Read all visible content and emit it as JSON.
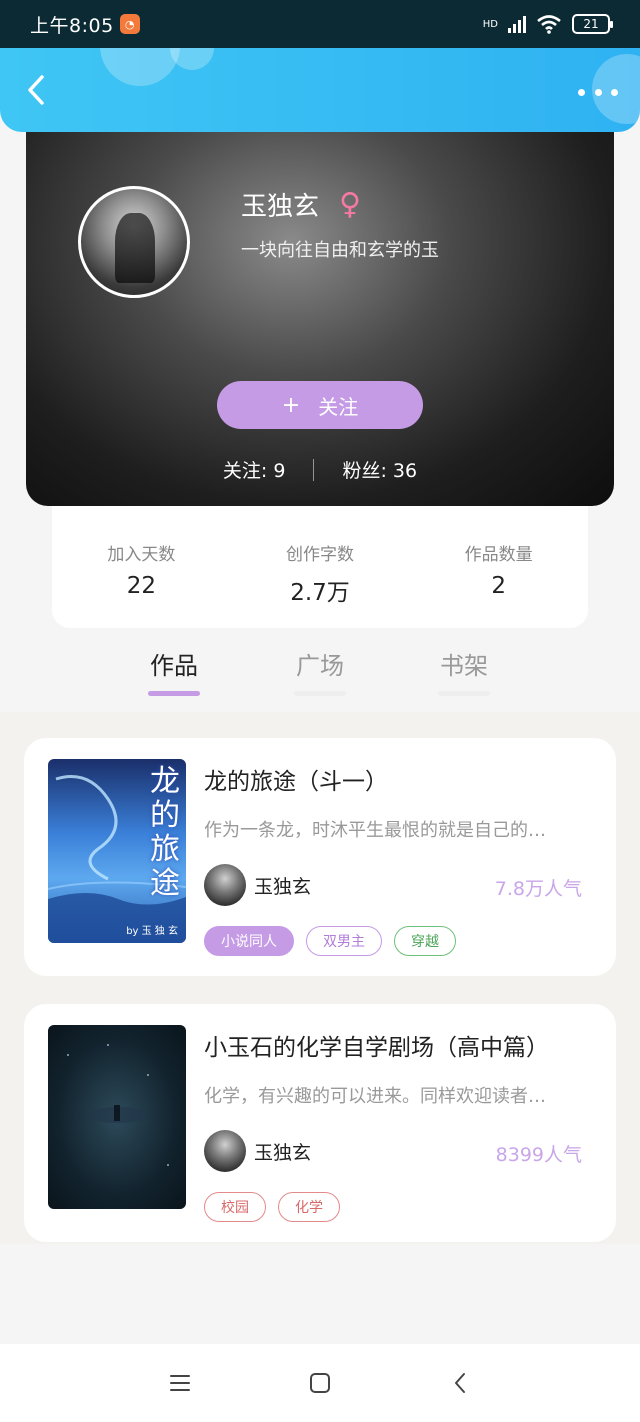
{
  "status_bar": {
    "time": "上午8:05",
    "network": "HD",
    "battery": "21"
  },
  "profile": {
    "username": "玉独玄",
    "gender_icon": "female-icon",
    "bio": "一块向往自由和玄学的玉",
    "follow_label": "关注",
    "follow_plus": "+",
    "following": "关注: 9",
    "followers": "粉丝: 36"
  },
  "stats": [
    {
      "label": "加入天数",
      "value": "22"
    },
    {
      "label": "创作字数",
      "value": "2.7万"
    },
    {
      "label": "作品数量",
      "value": "2"
    }
  ],
  "tabs": [
    {
      "label": "作品",
      "active": true
    },
    {
      "label": "广场",
      "active": false
    },
    {
      "label": "书架",
      "active": false
    }
  ],
  "works": [
    {
      "title": "龙的旅途（斗一）",
      "cover_text": "龙的旅途",
      "cover_by": "by 玉 独 玄",
      "desc": "作为一条龙，时沐平生最恨的就是自己的…",
      "author": "玉独玄",
      "popularity": "7.8万人气",
      "tags": [
        "小说同人",
        "双男主",
        "穿越"
      ]
    },
    {
      "title": "小玉石的化学自学剧场（高中篇）",
      "desc": "化学，有兴趣的可以进来。同样欢迎读者…",
      "author": "玉独玄",
      "popularity": "8399人气",
      "tags": [
        "校园",
        "化学"
      ]
    }
  ],
  "colors": {
    "header": "#2fb2f2",
    "accent": "#c59be6",
    "popularity": "#c9a6e8"
  }
}
